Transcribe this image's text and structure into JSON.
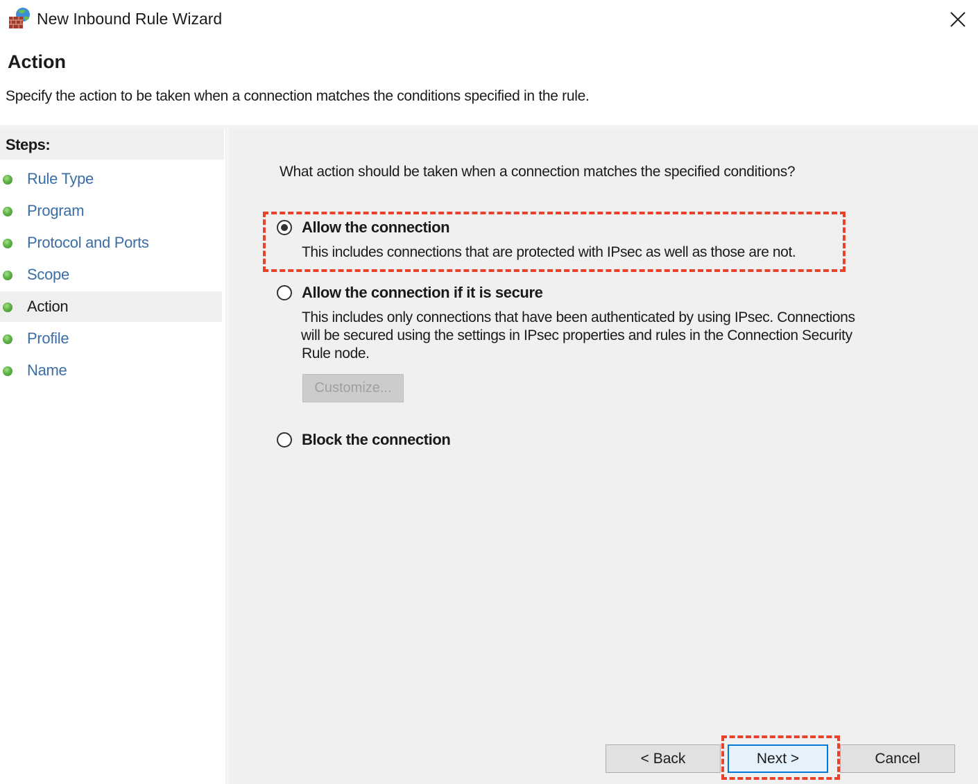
{
  "window": {
    "title": "New Inbound Rule Wizard",
    "icon": "firewall-globe-icon",
    "close_icon": "close-icon"
  },
  "header": {
    "title": "Action",
    "description": "Specify the action to be taken when a connection matches the conditions specified in the rule."
  },
  "steps": {
    "heading": "Steps:",
    "items": [
      {
        "label": "Rule Type",
        "active": false
      },
      {
        "label": "Program",
        "active": false
      },
      {
        "label": "Protocol and Ports",
        "active": false
      },
      {
        "label": "Scope",
        "active": false
      },
      {
        "label": "Action",
        "active": true
      },
      {
        "label": "Profile",
        "active": false
      },
      {
        "label": "Name",
        "active": false
      }
    ]
  },
  "main": {
    "question": "What action should be taken when a connection matches the specified conditions?",
    "options": [
      {
        "label": "Allow the connection",
        "description": "This includes connections that are protected with IPsec as well as those are not.",
        "selected": true
      },
      {
        "label": "Allow the connection if it is secure",
        "description_lines": [
          "This includes only connections that have been authenticated by using IPsec.  Connections",
          "will be secured using the settings in IPsec properties and rules in the Connection Security",
          "Rule node."
        ],
        "selected": false
      },
      {
        "label": "Block the connection",
        "selected": false
      }
    ],
    "customize_label": "Customize...",
    "customize_enabled": false
  },
  "footer": {
    "back_label": "< Back",
    "next_label": "Next >",
    "cancel_label": "Cancel"
  },
  "colors": {
    "highlight": "#e8412c",
    "step_link": "#3a6ea5",
    "default_button_border": "#0078d7"
  }
}
